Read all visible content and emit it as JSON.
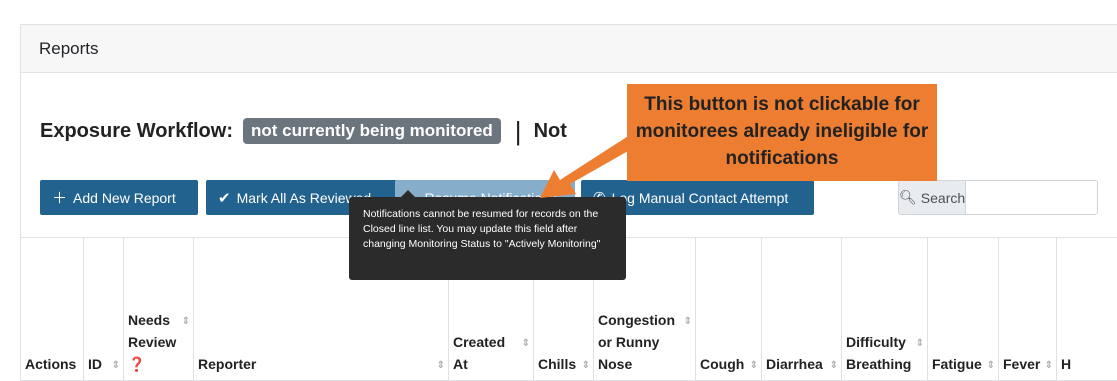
{
  "card": {
    "title": "Reports"
  },
  "workflow": {
    "label": "Exposure Workflow:",
    "status_badge": "not currently being monitored",
    "separator": "|",
    "notification_label_partial": "Not"
  },
  "toolbar": {
    "add_report": "Add New Report",
    "mark_reviewed": "Mark All As Reviewed",
    "resume_notifications": "Resume Notifications",
    "log_contact": "Log Manual Contact Attempt",
    "search_label": "Search",
    "search_value": ""
  },
  "tooltip": {
    "text": "Notifications cannot be resumed for records on the Closed line list. You may update this field after changing Monitoring Status to \"Actively Monitoring\""
  },
  "callout": {
    "text": "This button is not clickable for monitorees already ineligible for notifications",
    "color": "#ed7d31"
  },
  "table": {
    "columns": [
      {
        "label": "Actions",
        "sortable": false
      },
      {
        "label": "ID",
        "sortable": true
      },
      {
        "label": "Needs\nReview\n❓",
        "sortable": true
      },
      {
        "label": "Reporter",
        "sortable": true
      },
      {
        "label": "Created\nAt",
        "sortable": true
      },
      {
        "label": "Chills",
        "sortable": true
      },
      {
        "label": "Congestion\nor Runny\nNose",
        "sortable": true
      },
      {
        "label": "Cough",
        "sortable": true
      },
      {
        "label": "Diarrhea",
        "sortable": true
      },
      {
        "label": "Difficulty\nBreathing",
        "sortable": true
      },
      {
        "label": "Fatigue",
        "sortable": true
      },
      {
        "label": "Fever",
        "sortable": true
      },
      {
        "label": "H",
        "sortable": false
      }
    ]
  },
  "colors": {
    "primary_button": "#22628f",
    "disabled_button": "#86aecb",
    "badge": "#6c757d",
    "tooltip_bg": "#2b2b2b"
  },
  "icons": {
    "add": "plus-icon",
    "mark": "checkmark-icon",
    "resume": "play-icon",
    "log": "phone-icon",
    "search": "magnifier-icon",
    "sort": "sort-icon",
    "help": "question-circle-icon"
  }
}
